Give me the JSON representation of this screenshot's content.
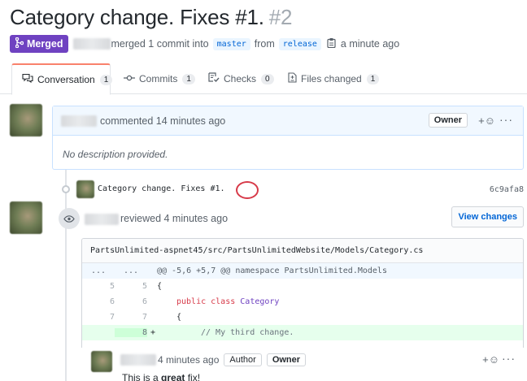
{
  "pr": {
    "title": "Category change. Fixes #1.",
    "number": "#2",
    "status": "Merged",
    "merged_text": "merged 1 commit into",
    "base_branch": "master",
    "from_text": "from",
    "head_branch": "release",
    "time": "a minute ago"
  },
  "tabs": [
    {
      "label": "Conversation",
      "count": "1"
    },
    {
      "label": "Commits",
      "count": "1"
    },
    {
      "label": "Checks",
      "count": "0"
    },
    {
      "label": "Files changed",
      "count": "1"
    }
  ],
  "comment": {
    "action": "commented 14 minutes ago",
    "role": "Owner",
    "body": "No description provided."
  },
  "commit": {
    "message": "Category change. Fixes #1.",
    "sha": "6c9afa8"
  },
  "review": {
    "action": "reviewed 4 minutes ago",
    "button": "View changes"
  },
  "diff": {
    "file": "PartsUnlimited-aspnet45/src/PartsUnlimitedWebsite/Models/Category.cs",
    "hunk_marker": "...",
    "hunk": "@@ -5,6 +5,7 @@ namespace PartsUnlimited.Models",
    "lines": [
      {
        "old": "5",
        "new": "5",
        "text": "{"
      },
      {
        "old": "6",
        "new": "6",
        "kw": "public class",
        "cls": "Category"
      },
      {
        "old": "7",
        "new": "7",
        "text": "{"
      },
      {
        "old": "",
        "new": "8",
        "sign": "+",
        "comment": "// My third change."
      }
    ]
  },
  "reply": {
    "time": "4 minutes ago",
    "badge_author": "Author",
    "badge_owner": "Owner",
    "text_prefix": "This is a",
    "text_bold": "great",
    "text_suffix": "fix!"
  },
  "icons": {
    "merge": "git-merge-icon",
    "copy": "clipboard-icon",
    "conversation": "comment-discussion-icon",
    "commits": "git-commit-icon",
    "checks": "checklist-icon",
    "files": "file-diff-icon",
    "reaction": "smiley-icon",
    "more": "kebab-horizontal-icon",
    "eye": "eye-icon"
  },
  "colors": {
    "merged": "#6f42c1",
    "link": "#0366d6",
    "tab_accent": "#f9826c",
    "highlight": "#d73a49"
  }
}
